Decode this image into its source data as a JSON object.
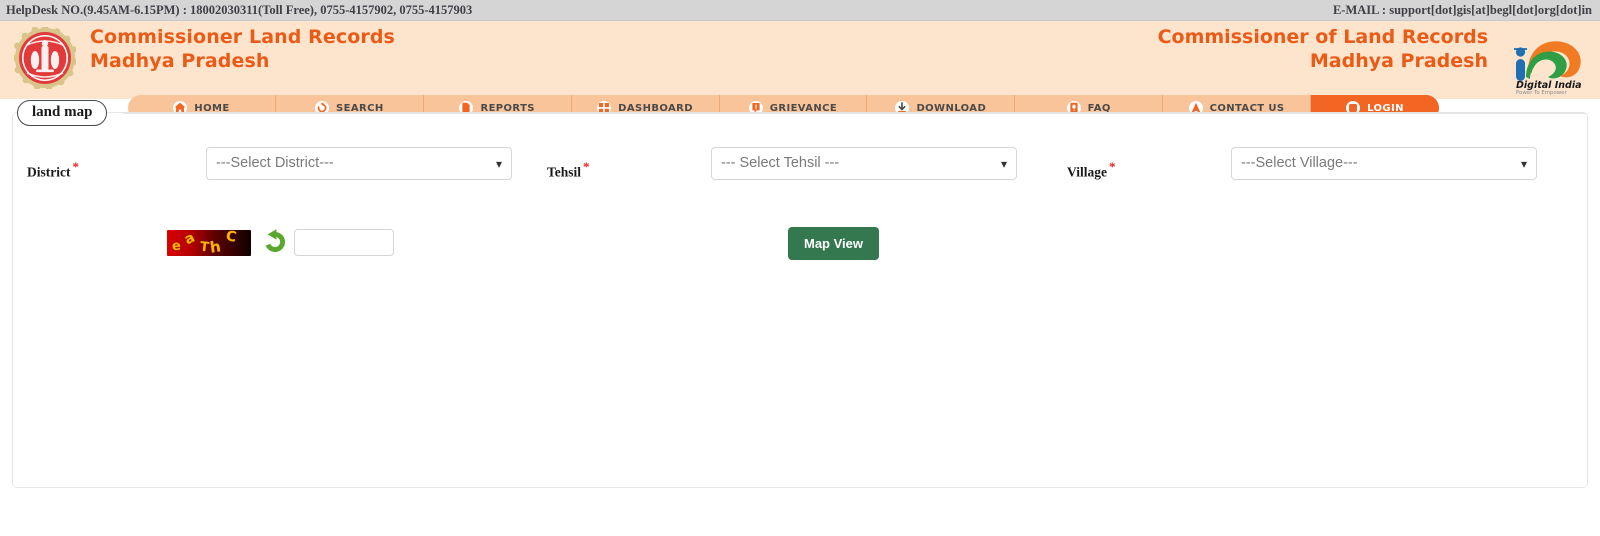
{
  "topbar": {
    "helpdesk": "HelpDesk NO.(9.45AM-6.15PM) : 18002030311(Toll Free), 0755-4157902, 0755-4157903",
    "email": "E-MAIL : support[dot]gis[at]begl[dot]org[dot]in"
  },
  "header": {
    "title_left_line1": "Commissioner Land Records",
    "title_left_line2": "Madhya Pradesh",
    "title_right_line1": "Commissioner of Land Records",
    "title_right_line2": "Madhya Pradesh",
    "digital_india_name": "Digital India",
    "digital_india_tagline": "Power To Empower",
    "emblem_icon": "mp-government-emblem-icon",
    "digital_india_icon": "digital-india-logo-icon"
  },
  "nav": {
    "items": [
      {
        "label": "HOME",
        "icon": "home-icon",
        "active": false
      },
      {
        "label": "SEARCH",
        "icon": "refresh-search-icon",
        "active": false
      },
      {
        "label": "REPORTS",
        "icon": "report-icon",
        "active": false
      },
      {
        "label": "DASHBOARD",
        "icon": "dashboard-icon",
        "active": false
      },
      {
        "label": "GRIEVANCE",
        "icon": "grievance-icon",
        "active": false
      },
      {
        "label": "DOWNLOAD",
        "icon": "download-icon",
        "active": false
      },
      {
        "label": "FAQ",
        "icon": "faq-icon",
        "active": false
      },
      {
        "label": "CONTACT US",
        "icon": "contact-icon",
        "active": false
      },
      {
        "label": "LOGIN",
        "icon": "login-icon",
        "active": true
      }
    ]
  },
  "panel": {
    "tab_label": "land map",
    "fields": [
      {
        "label": "District",
        "required": "*",
        "value": "---Select District---"
      },
      {
        "label": "Tehsil",
        "required": "*",
        "value": "--- Select Tehsil ---"
      },
      {
        "label": "Village",
        "required": "*",
        "value": "---Select Village---"
      }
    ],
    "captcha": {
      "chars": [
        "e",
        "a",
        "T",
        "h",
        "C"
      ],
      "text": "eaThC",
      "input_value": "",
      "input_placeholder": "",
      "refresh_icon": "refresh-captcha-icon"
    },
    "map_view_label": "Map View"
  },
  "colors": {
    "brand_orange": "#ea5b17",
    "nav_bg": "#fac49a",
    "nav_active": "#f26522",
    "header_bg": "#fde5cd",
    "button_green": "#34784f",
    "required_red": "#e02020",
    "topbar_bg": "#d5d5d5"
  }
}
